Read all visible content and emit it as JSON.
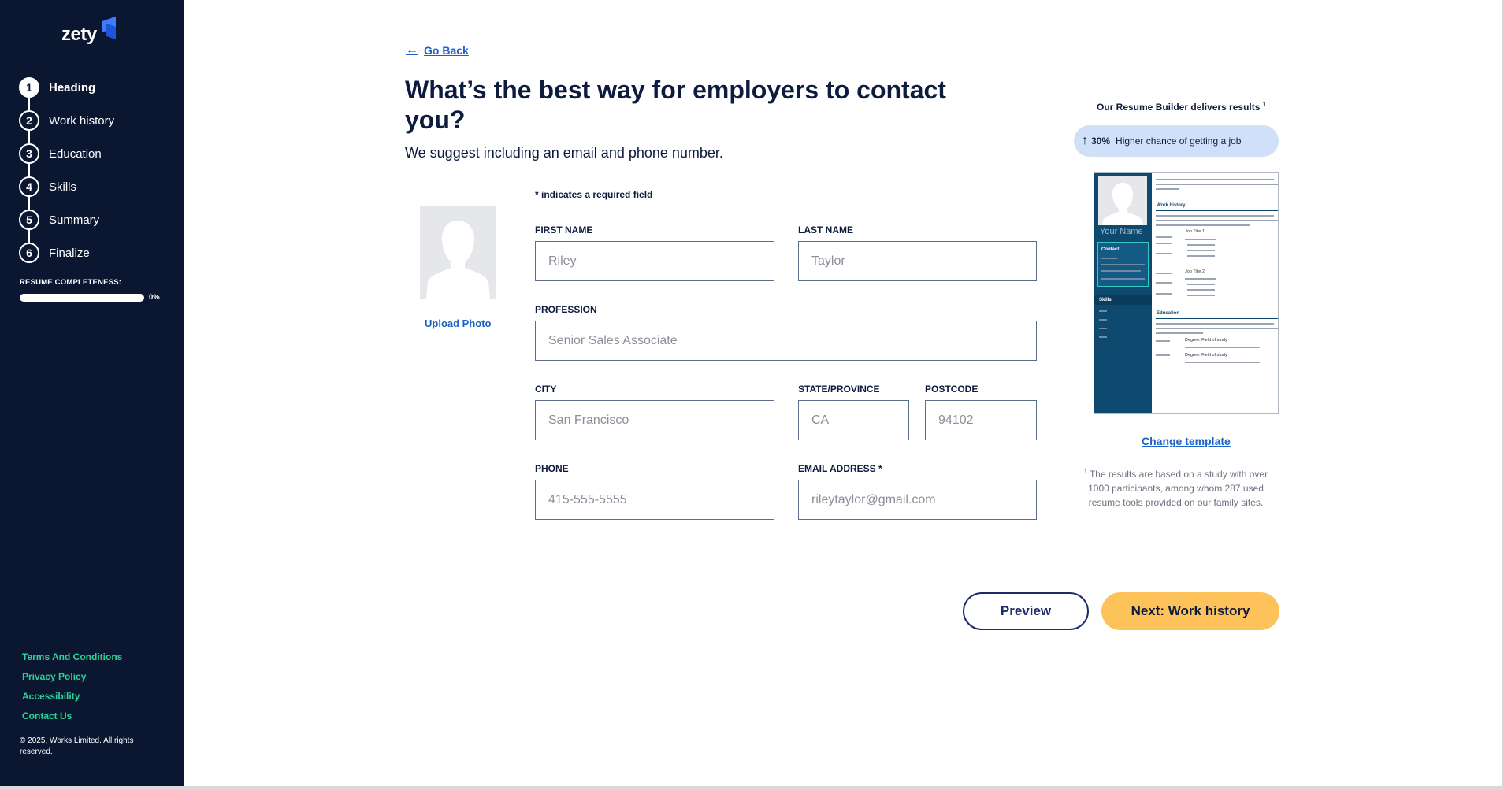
{
  "brand": {
    "logo_text": "zety"
  },
  "sidebar": {
    "steps": [
      {
        "number": "1",
        "label": "Heading",
        "active": true
      },
      {
        "number": "2",
        "label": "Work history",
        "active": false
      },
      {
        "number": "3",
        "label": "Education",
        "active": false
      },
      {
        "number": "4",
        "label": "Skills",
        "active": false
      },
      {
        "number": "5",
        "label": "Summary",
        "active": false
      },
      {
        "number": "6",
        "label": "Finalize",
        "active": false
      }
    ],
    "completeness_label": "RESUME COMPLETENESS:",
    "completeness_percent_text": "0%",
    "completeness_value": 0,
    "footer_links": [
      "Terms And Conditions",
      "Privacy Policy",
      "Accessibility",
      "Contact Us"
    ],
    "copyright": "© 2025, Works Limited. All rights reserved."
  },
  "main": {
    "go_back": "Go Back",
    "title": "What’s the best way for employers to contact you?",
    "subtitle": "We suggest including an email and phone number.",
    "required_note": "* indicates a required field",
    "upload_photo": "Upload Photo",
    "fields": {
      "first_name": {
        "label": "FIRST NAME",
        "placeholder": "Riley"
      },
      "last_name": {
        "label": "LAST NAME",
        "placeholder": "Taylor"
      },
      "profession": {
        "label": "PROFESSION",
        "placeholder": "Senior Sales Associate"
      },
      "city": {
        "label": "CITY",
        "placeholder": "San Francisco"
      },
      "state": {
        "label": "STATE/PROVINCE",
        "placeholder": "CA"
      },
      "postcode": {
        "label": "POSTCODE",
        "placeholder": "94102"
      },
      "phone": {
        "label": "PHONE",
        "placeholder": "415-555-5555"
      },
      "email": {
        "label": "EMAIL ADDRESS *",
        "placeholder": "rileytaylor@gmail.com"
      }
    }
  },
  "right_panel": {
    "results_title": "Our Resume Builder delivers results",
    "results_sup": "1",
    "stat_value": "30%",
    "stat_text": "Higher chance of getting a job",
    "template_preview": {
      "name": "Your Name",
      "contact_heading": "Contact",
      "skills_heading": "Skills",
      "work_history_heading": "Work history",
      "education_heading": "Education",
      "job_title_1": "Job Title 1",
      "job_title_2": "Job Title 2",
      "degree": "Degree: Field of study"
    },
    "change_template": "Change template",
    "study_sup": "1",
    "study_note": "The results are based on a study with over 1000 participants, among whom 287 used resume tools provided on our family sites."
  },
  "actions": {
    "preview": "Preview",
    "next": "Next: Work history"
  },
  "colors": {
    "sidebar_bg": "#0b1630",
    "link_blue": "#1b62c8",
    "footer_green": "#2ed197",
    "next_button": "#fdc35a",
    "pill_bg": "#cfe0f8",
    "template_sidebar": "#0e4a6f"
  }
}
